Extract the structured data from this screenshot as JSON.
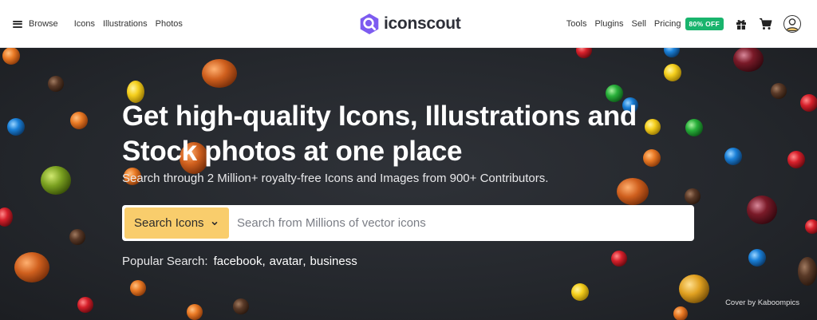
{
  "nav": {
    "browse_label": "Browse",
    "links": [
      "Icons",
      "Illustrations",
      "Photos"
    ],
    "logo_text": "iconscout",
    "right_links": [
      "Tools",
      "Plugins",
      "Sell",
      "Pricing"
    ],
    "badge": "80% OFF",
    "icons": [
      "gift-icon",
      "cart-icon",
      "user-avatar-icon"
    ]
  },
  "hero": {
    "headline": "Get high-quality Icons, Illustrations and Stock photos at one place",
    "subline": "Search through 2 Million+ royalty-free Icons and Images from 900+ Contributors.",
    "search": {
      "category": "Search Icons",
      "placeholder": "Search from Millions of vector icons"
    },
    "popular_label": "Popular Search:",
    "popular_terms": [
      "facebook",
      "avatar",
      "business"
    ],
    "credit": "Cover by Kaboompics"
  },
  "colors": {
    "accent_yellow": "#f9cd6c",
    "badge_green": "#19b46d",
    "logo_purple": "#7d5cf0",
    "hero_bg": "#25282d"
  }
}
